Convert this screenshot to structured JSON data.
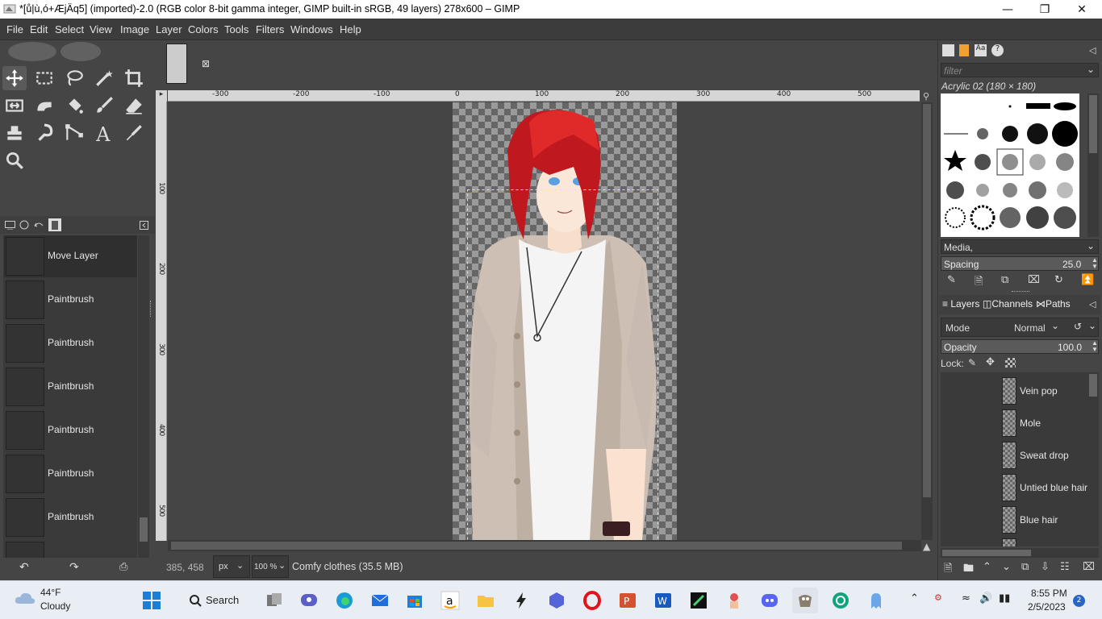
{
  "window": {
    "title": "*[ů|ù,ó+ÆjÄq5] (imported)-2.0 (RGB color 8-bit gamma integer, GIMP built-in sRGB, 49 layers) 278x600 – GIMP",
    "minimize_icon": "minimize-icon",
    "maximize_icon": "restore-icon",
    "close_icon": "close-icon"
  },
  "menu": [
    "File",
    "Edit",
    "Select",
    "View",
    "Image",
    "Layer",
    "Colors",
    "Tools",
    "Filters",
    "Windows",
    "Help"
  ],
  "toolbox": {
    "tools": [
      "move-tool",
      "rect-select-tool",
      "free-select-tool",
      "fuzzy-select-tool",
      "crop-tool",
      "unified-transform-tool",
      "warp-transform-tool",
      "bucket-fill-tool",
      "paintbrush-tool",
      "eraser-tool",
      "clone-tool",
      "smudge-tool",
      "paths-tool",
      "text-tool",
      "color-picker-tool",
      "zoom-tool"
    ],
    "foreground_color": "#000000",
    "background_color": "#ffffff"
  },
  "undo_history": {
    "items": [
      "Move Layer",
      "Paintbrush",
      "Paintbrush",
      "Paintbrush",
      "Paintbrush",
      "Paintbrush",
      "Paintbrush"
    ],
    "selected_index": 0
  },
  "rulers": {
    "horizontal": [
      "-300",
      "-200",
      "-100",
      "0",
      "100",
      "200",
      "300",
      "400",
      "500"
    ],
    "vertical": [
      "100",
      "200",
      "300",
      "400",
      "500"
    ]
  },
  "status": {
    "coordinates": "385, 458",
    "unit": "px",
    "zoom": "100 %",
    "message": "Comfy clothes (35.5 MB)"
  },
  "brushes": {
    "filter_placeholder": "filter",
    "selected_brush": "Acrylic 02 (180 × 180)",
    "tag": "Media,",
    "spacing_label": "Spacing",
    "spacing_value": "25.0"
  },
  "layers_panel": {
    "tabs": [
      "Layers",
      "Channels",
      "Paths"
    ],
    "mode_label": "Mode",
    "mode_value": "Normal",
    "opacity_label": "Opacity",
    "opacity_value": "100.0",
    "lock_label": "Lock:",
    "layers": [
      "Vein pop",
      "Mole",
      "Sweat drop",
      "Untied blue hair",
      "Blue hair"
    ]
  },
  "taskbar": {
    "weather_temp": "44°F",
    "weather_desc": "Cloudy",
    "search_label": "Search",
    "time": "8:55 PM",
    "date": "2/5/2023",
    "notification_count": "2"
  }
}
